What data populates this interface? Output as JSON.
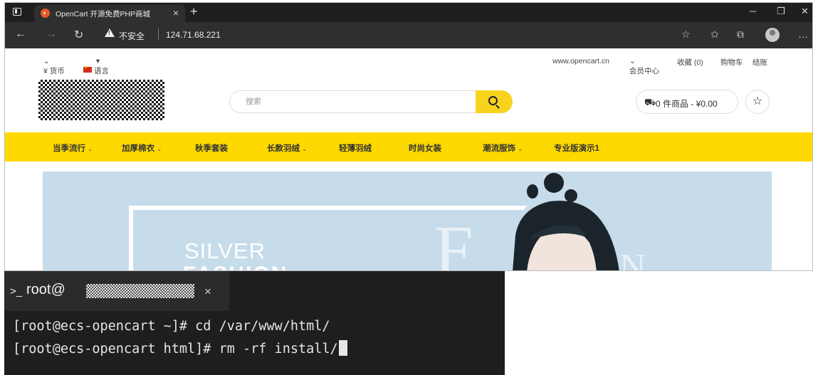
{
  "browser": {
    "tab": {
      "title": "OpenCart 开源免费PHP商城",
      "favicon": "opencart-icon"
    },
    "address": {
      "security_label": "不安全",
      "url": "124.71.68.221"
    }
  },
  "store": {
    "topbar": {
      "currency": "¥ 货币",
      "language": "语言",
      "site": "www.opencart.cn",
      "account": "会员中心",
      "wishlist": "收藏 (0)",
      "cart": "购物车",
      "checkout": "结账"
    },
    "search": {
      "placeholder": "搜索"
    },
    "cart_summary": "0 件商品 - ¥0.00",
    "menu": [
      {
        "label": "当季流行",
        "has_dropdown": true
      },
      {
        "label": "加厚棉衣",
        "has_dropdown": true
      },
      {
        "label": "秋季套装",
        "has_dropdown": false
      },
      {
        "label": "长款羽绒",
        "has_dropdown": true
      },
      {
        "label": "轻薄羽绒",
        "has_dropdown": false
      },
      {
        "label": "时尚女装",
        "has_dropdown": false
      },
      {
        "label": "潮流服饰",
        "has_dropdown": true
      },
      {
        "label": "专业版演示1",
        "has_dropdown": false
      }
    ],
    "banner": {
      "line1": "SILVER",
      "line2": "FASHION",
      "letter1": "F",
      "letter2": "N"
    },
    "colors": {
      "accent": "#fed901",
      "banner_bg": "#c6dcea"
    }
  },
  "terminal": {
    "tab_title": "root@",
    "lines": [
      "[root@ecs-opencart ~]# cd /var/www/html/",
      "[root@ecs-opencart html]# rm -rf install/"
    ]
  }
}
